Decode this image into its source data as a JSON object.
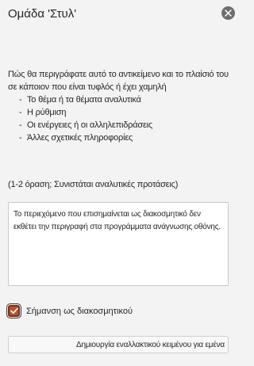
{
  "pane": {
    "title": "Ομάδα 'Στυλ'",
    "close_icon": "close-icon"
  },
  "description": {
    "intro": "Πώς θα περιγράφατε αυτό το αντικείμενο και το πλαίσιό του σε κάποιον που είναι τυφλός ή έχει χαμηλή",
    "items": [
      "Το θέμα ή τα θέματα αναλυτικά",
      "Η ρύθμιση",
      "Οι ενέργειες ή οι αλληλεπιδράσεις",
      "Άλλες σχετικές πληροφορίες"
    ]
  },
  "hint": "(1-2 όραση; Συνιστάται αναλυτικές προτάσεις)",
  "alt_text": {
    "value": "Το περιεχόμενο που επισημαίνεται ως διακοσμητικό δεν εκθέτει την περιγραφή στα προγράμματα ανάγνωσης οθόνης."
  },
  "decorative": {
    "label": "Σήμανση ως διακοσμητικού",
    "checked": true,
    "accent_color": "#b4552e"
  },
  "generate_button": {
    "label": "Δημιουργία εναλλακτικού κειμένου για εμένα"
  }
}
